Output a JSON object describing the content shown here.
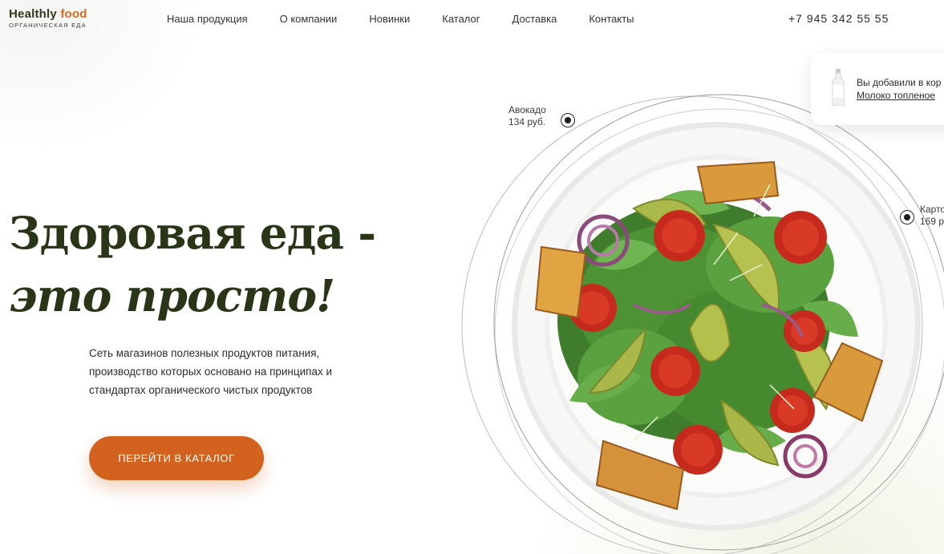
{
  "header": {
    "logo": {
      "word1": "Healthly",
      "word2": "food",
      "tagline": "ОРГАНИЧЕСКАЯ ЕДА"
    },
    "nav": [
      {
        "label": "Наша продукция"
      },
      {
        "label": "О компании"
      },
      {
        "label": "Новинки"
      },
      {
        "label": "Каталог"
      },
      {
        "label": "Доставка"
      },
      {
        "label": "Контакты"
      }
    ],
    "phone": "+7 945 342 55 55"
  },
  "hero": {
    "title_line1": "Здоровая еда -",
    "title_line2": "это просто!",
    "description": "Сеть магазинов полезных продуктов питания, производство которых основано на принципах и стандартах органического чистых продуктов",
    "cta_label": "ПЕРЕЙТИ В КАТАЛОГ"
  },
  "markers": [
    {
      "name": "Авокадо",
      "price": "134 руб."
    },
    {
      "name": "Карто",
      "price": "169 р"
    }
  ],
  "cart_popup": {
    "message": "Вы добавили в кор",
    "product": "Молоко топленое"
  },
  "colors": {
    "accent": "#d2621e",
    "brand_dark": "#2f3a1c",
    "headline": "#2a3517"
  },
  "icons": {
    "bottle": "milk-bottle-icon",
    "marker": "marker-dot-icon"
  }
}
